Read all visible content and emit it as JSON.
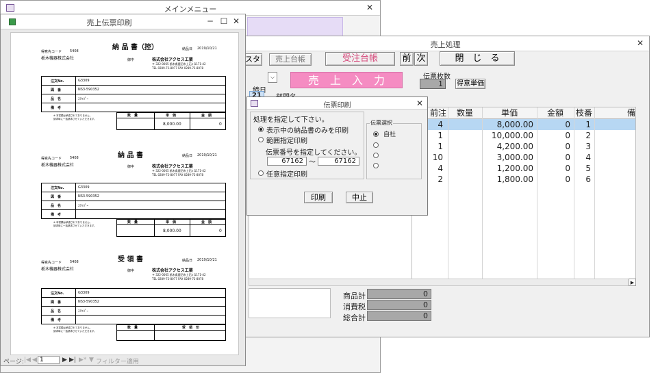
{
  "main_menu": {
    "title": "メインメニュー",
    "close": "✕"
  },
  "sales_window": {
    "title": "売上処理",
    "close": "✕",
    "tabs": [
      "スタ",
      "売上台帳",
      "受注台帳"
    ],
    "nav_prev": "前",
    "nav_next": "次",
    "close_button": "閉　じ　る",
    "sales_input": "売　上　入　力",
    "slip_count_label": "伝票枚数",
    "slip_count_value": "1",
    "customer_price_button": "得意単価",
    "date_label": "締日",
    "date_value": "21",
    "dept_label": "部門名",
    "columns": [
      "前注",
      "数量",
      "単価",
      "金額",
      "枝番",
      "備"
    ],
    "rows": [
      {
        "prev": "4",
        "qty": "",
        "price": "8,000.00",
        "amount": "0",
        "branch": "1"
      },
      {
        "prev": "1",
        "qty": "",
        "price": "10,000.00",
        "amount": "0",
        "branch": "2"
      },
      {
        "prev": "1",
        "qty": "",
        "price": "4,200.00",
        "amount": "0",
        "branch": "3"
      },
      {
        "prev": "10",
        "qty": "",
        "price": "3,000.00",
        "amount": "0",
        "branch": "4"
      },
      {
        "prev": "4",
        "qty": "",
        "price": "1,200.00",
        "amount": "0",
        "branch": "5"
      },
      {
        "prev": "2",
        "qty": "",
        "price": "1,800.00",
        "amount": "0",
        "branch": "6"
      }
    ],
    "totals": [
      {
        "label": "商品計",
        "value": "0"
      },
      {
        "label": "消費税",
        "value": "0"
      },
      {
        "label": "総合計",
        "value": "0"
      }
    ]
  },
  "print_dialog": {
    "title": "伝票印刷",
    "close": "✕",
    "instruction": "処理を指定して下さい。",
    "options": [
      "表示中の納品書のみを印刷",
      "範囲指定印刷",
      "任意指定印刷"
    ],
    "range_prompt": "伝票番号を指定してください。",
    "range_from": "67162",
    "range_tilde": "〜",
    "range_to": "67162",
    "group_label": "伝票選択",
    "select_options": [
      "自社",
      "",
      "",
      ""
    ],
    "print_button": "印刷",
    "cancel_button": "中止"
  },
  "preview_window": {
    "title": "売上伝票印刷",
    "min": "─",
    "max": "☐",
    "close": "✕",
    "page_label": "ページ:",
    "page_value": "1",
    "filter_label": "フィルター適用",
    "sections": [
      {
        "heading": "納 品 書（控）",
        "customer_code_label": "得意先コード",
        "customer_code": "5408",
        "customer_name": "栃木機器株式会社",
        "honorific": "御中",
        "date_label": "納品日",
        "date": "2019/10/21",
        "company": "株式会社アクセス工業",
        "addr": "〒 322-0065  栃木県鹿沼市上石川1171-42",
        "tel": "TEL 0289-72-8077    FAX 0289-72-8078",
        "rows": [
          {
            "label": "注文No.",
            "value": "G3309"
          },
          {
            "label": "図　番",
            "value": "NS3-590352"
          },
          {
            "label": "品　名",
            "value": "ｽﾘｯﾊﾟｰ"
          },
          {
            "label": "備　考",
            "value": ""
          }
        ],
        "note1": "※ 本書類は承認されておりません。",
        "note2": "  請求時に一括請求させていただきます。",
        "amount_headers": [
          "数　量",
          "単　価",
          "金　額"
        ],
        "unit_price": "8,000.00",
        "amount": "0"
      },
      {
        "heading": "納 品 書",
        "customer_code_label": "得意先コード",
        "customer_code": "5408",
        "customer_name": "栃木機器株式会社",
        "honorific": "御中",
        "date_label": "納品日",
        "date": "2019/10/21",
        "company": "株式会社アクセス工業",
        "addr": "〒 322-0065  栃木県鹿沼市上石川1171-42",
        "tel": "TEL 0289-72-8077    FAX 0289-72-8078",
        "rows": [
          {
            "label": "注文No.",
            "value": "G3309"
          },
          {
            "label": "図　番",
            "value": "NS3-590352"
          },
          {
            "label": "品　名",
            "value": "ｽﾘｯﾊﾟｰ"
          },
          {
            "label": "備　考",
            "value": ""
          }
        ],
        "note1": "※ 本書類は承認されておりません。",
        "note2": "  請求時に一括請求させていただきます。",
        "amount_headers": [
          "数　量",
          "単　価",
          "金　額"
        ],
        "unit_price": "8,000.00",
        "amount": "0"
      },
      {
        "heading": "受 領 書",
        "customer_code_label": "得意先コード",
        "customer_code": "5408",
        "customer_name": "栃木機器株式会社",
        "honorific": "御中",
        "date_label": "納品日",
        "date": "2019/10/21",
        "company": "株式会社アクセス工業",
        "addr": "〒 322-0065  栃木県鹿沼市上石川1171-42",
        "tel": "TEL 0289-72-8077    FAX 0289-72-8078",
        "rows": [
          {
            "label": "注文No.",
            "value": "G3309"
          },
          {
            "label": "図　番",
            "value": "NS3-590352"
          },
          {
            "label": "品　名",
            "value": "ｽﾘｯﾊﾟｰ"
          },
          {
            "label": "備　考",
            "value": ""
          }
        ],
        "note1": "※ 本書類は承認されておりません。",
        "note2": "  請求時に一括請求させていただきます。",
        "amount_headers": [
          "数　量",
          "受　領　印"
        ]
      }
    ]
  }
}
